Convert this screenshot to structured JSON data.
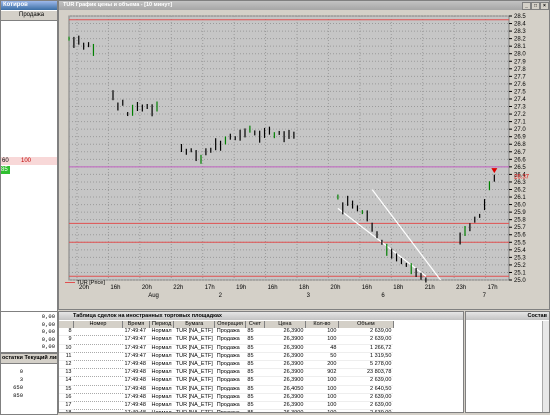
{
  "left_panel": {
    "top_title": "Котиров",
    "header_col": "Продажа",
    "row_cells": [
      "60",
      "100"
    ],
    "green_cell": "85"
  },
  "left_lower": {
    "values": [
      "0,00",
      "0,00",
      "0,00",
      "0,00",
      "0,00"
    ]
  },
  "left_bottom": {
    "title": "остатки Текущий лими",
    "values": [
      "0",
      "3 650",
      "850"
    ]
  },
  "chart_window": {
    "title": "TUR График цены и объема - [10 минут]",
    "legend": "TUR [Price]",
    "price_tag": "26.37"
  },
  "deals_window": {
    "title": "Таблица сделок на иностранных торговых площадках",
    "right_title": "Состав",
    "columns": [
      "",
      "Номер",
      "Время",
      "Период",
      "Бумага",
      "Операция",
      "Счет",
      "Цена",
      "Кол-во",
      "Объем"
    ],
    "rows": [
      [
        "8",
        "",
        "17:49:47",
        "Нормал",
        "TUR [NA_ETF]",
        "Продажа",
        "85",
        "26,3900",
        "100",
        "2 639,00"
      ],
      [
        "9",
        "",
        "17:49:47",
        "Нормал",
        "TUR [NA_ETF]",
        "Продажа",
        "85",
        "26,3900",
        "100",
        "2 639,00"
      ],
      [
        "10",
        "",
        "17:49:47",
        "Нормал",
        "TUR [NA_ETF]",
        "Продажа",
        "85",
        "26,3900",
        "48",
        "1 266,72"
      ],
      [
        "11",
        "",
        "17:49:47",
        "Нормал",
        "TUR [NA_ETF]",
        "Продажа",
        "85",
        "26,3900",
        "50",
        "1 319,50"
      ],
      [
        "12",
        "",
        "17:49:48",
        "Нормал",
        "TUR [NA_ETF]",
        "Продажа",
        "85",
        "26,3900",
        "200",
        "5 278,00"
      ],
      [
        "13",
        "",
        "17:49:48",
        "Нормал",
        "TUR [NA_ETF]",
        "Продажа",
        "85",
        "26,3900",
        "902",
        "23 803,78"
      ],
      [
        "14",
        "",
        "17:49:48",
        "Нормал",
        "TUR [NA_ETF]",
        "Продажа",
        "85",
        "26,3900",
        "100",
        "2 639,00"
      ],
      [
        "15",
        "",
        "17:49:48",
        "Нормал",
        "TUR [NA_ETF]",
        "Продажа",
        "85",
        "26,4050",
        "100",
        "2 640,50"
      ],
      [
        "16",
        "",
        "17:49:48",
        "Нормал",
        "TUR [NA_ETF]",
        "Продажа",
        "85",
        "26,3900",
        "100",
        "2 639,00"
      ],
      [
        "17",
        "",
        "17:49:48",
        "Нормал",
        "TUR [NA_ETF]",
        "Продажа",
        "85",
        "26,3900",
        "100",
        "2 639,00"
      ],
      [
        "18",
        "",
        "17:49:48",
        "Нормал",
        "TUR [NA_ETF]",
        "Продажа",
        "85",
        "26,3900",
        "100",
        "2 639,00"
      ]
    ]
  },
  "chart_data": {
    "type": "line",
    "ylim": [
      25.0,
      28.5
    ],
    "y_ticks": [
      "28.5",
      "28.4",
      "28.3",
      "28.2",
      "28.1",
      "28.0",
      "27.9",
      "27.8",
      "27.7",
      "27.6",
      "27.5",
      "27.4",
      "27.3",
      "27.2",
      "27.1",
      "27.0",
      "26.9",
      "26.8",
      "26.7",
      "26.6",
      "26.5",
      "26.4",
      "26.3",
      "26.2",
      "26.1",
      "26.0",
      "25.9",
      "25.8",
      "25.7",
      "25.6",
      "25.5",
      "25.4",
      "25.3",
      "25.2",
      "25.1",
      "25.0"
    ],
    "x_ticks": [
      "20h",
      "16h",
      "20h",
      "22h",
      "17h",
      "19h",
      "16h",
      "18h",
      "20h",
      "16h",
      "18h",
      "21h",
      "23h",
      "17h"
    ],
    "x_dates": [
      "Aug",
      "2",
      "3",
      "6",
      "7"
    ],
    "horizontal_levels": [
      {
        "y": 28.45,
        "color": "#e05050"
      },
      {
        "y": 26.5,
        "color": "#c060c0"
      },
      {
        "y": 25.75,
        "color": "#e05050"
      },
      {
        "y": 25.5,
        "color": "#e05050"
      },
      {
        "y": 25.05,
        "color": "#e05050"
      }
    ],
    "series": [
      {
        "values": [
          [
            0,
            28.2
          ],
          [
            1,
            28.15
          ],
          [
            2,
            28.18
          ],
          [
            3,
            28.1
          ],
          [
            4,
            28.12
          ],
          [
            5,
            28.05
          ],
          [
            9,
            27.45
          ],
          [
            10,
            27.3
          ],
          [
            11,
            27.35
          ],
          [
            12,
            27.2
          ],
          [
            13,
            27.25
          ],
          [
            14,
            27.3
          ],
          [
            15,
            27.28
          ],
          [
            16,
            27.3
          ],
          [
            17,
            27.25
          ],
          [
            18,
            27.3
          ],
          [
            23,
            26.75
          ],
          [
            24,
            26.7
          ],
          [
            25,
            26.72
          ],
          [
            26,
            26.65
          ],
          [
            27,
            26.6
          ],
          [
            28,
            26.7
          ],
          [
            29,
            26.72
          ],
          [
            30,
            26.8
          ],
          [
            31,
            26.78
          ],
          [
            32,
            26.85
          ],
          [
            33,
            26.9
          ],
          [
            34,
            26.88
          ],
          [
            35,
            26.92
          ],
          [
            36,
            26.95
          ],
          [
            37,
            27.0
          ],
          [
            38,
            26.95
          ],
          [
            39,
            26.9
          ],
          [
            40,
            26.95
          ],
          [
            41,
            26.98
          ],
          [
            42,
            26.92
          ],
          [
            43,
            26.95
          ],
          [
            44,
            26.9
          ],
          [
            45,
            26.93
          ],
          [
            46,
            26.92
          ],
          [
            55,
            26.1
          ],
          [
            56,
            25.95
          ],
          [
            57,
            26.05
          ],
          [
            58,
            26.0
          ],
          [
            59,
            25.95
          ],
          [
            60,
            25.9
          ],
          [
            61,
            25.85
          ],
          [
            62,
            25.7
          ],
          [
            63,
            25.6
          ],
          [
            64,
            25.5
          ],
          [
            65,
            25.4
          ],
          [
            66,
            25.35
          ],
          [
            67,
            25.3
          ],
          [
            68,
            25.25
          ],
          [
            69,
            25.2
          ],
          [
            70,
            25.15
          ],
          [
            71,
            25.1
          ],
          [
            72,
            25.05
          ],
          [
            73,
            25.0
          ],
          [
            80,
            25.55
          ],
          [
            81,
            25.65
          ],
          [
            82,
            25.7
          ],
          [
            83,
            25.8
          ],
          [
            84,
            25.85
          ],
          [
            85,
            26.0
          ],
          [
            86,
            26.25
          ],
          [
            87,
            26.35
          ]
        ]
      }
    ],
    "trendlines": [
      {
        "from": [
          55,
          25.95
        ],
        "to": [
          73,
          25.05
        ]
      },
      {
        "from": [
          62,
          26.2
        ],
        "to": [
          76,
          25.0
        ]
      }
    ]
  }
}
